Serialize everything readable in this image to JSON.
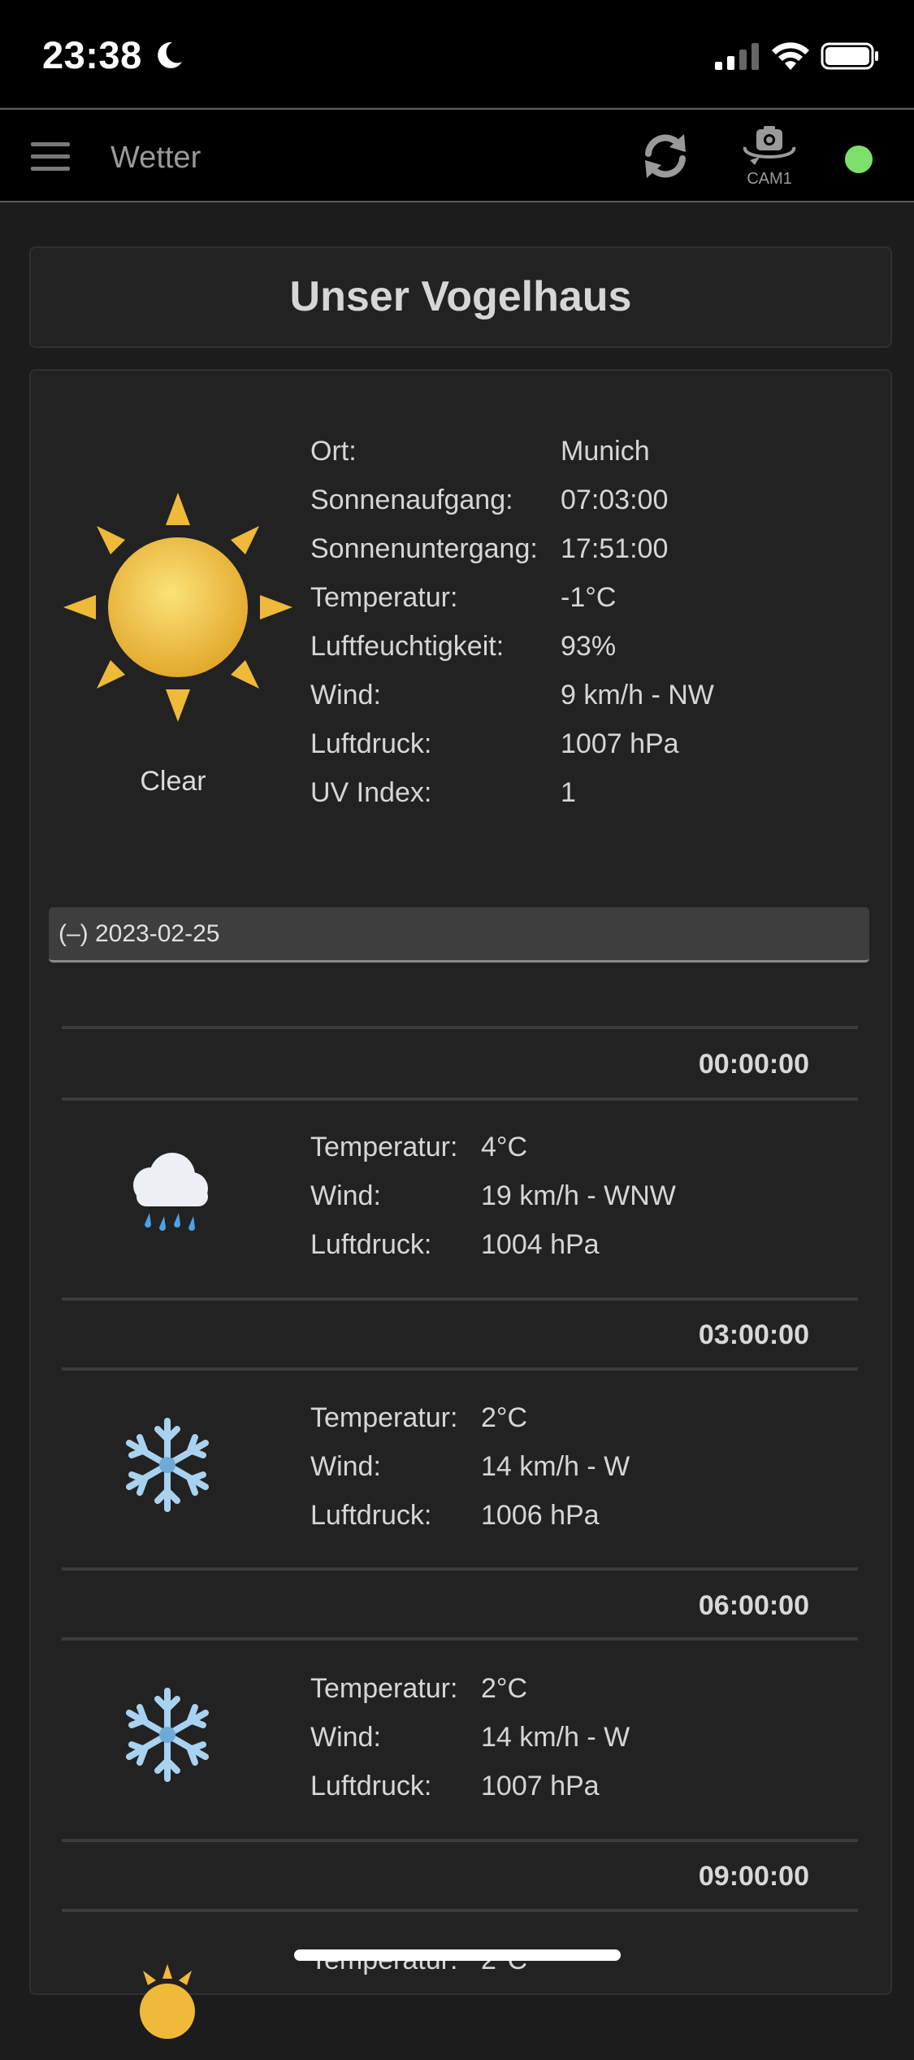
{
  "status_bar": {
    "time": "23:38",
    "icons": [
      "moon-icon",
      "cellular-signal-icon",
      "wifi-icon",
      "battery-icon"
    ]
  },
  "app_bar": {
    "title": "Wetter",
    "cam_label": "CAM1",
    "status_color": "#7ee06c",
    "icons": [
      "menu-icon",
      "refresh-icon",
      "camera-rotate-icon"
    ]
  },
  "page_title": "Unser Vogelhaus",
  "current": {
    "icon": "sun-icon",
    "condition": "Clear",
    "rows": [
      {
        "label": "Ort:",
        "value": "Munich"
      },
      {
        "label": "Sonnenaufgang:",
        "value": "07:03:00"
      },
      {
        "label": "Sonnenuntergang:",
        "value": "17:51:00"
      },
      {
        "label": "Temperatur:",
        "value": "-1°C"
      },
      {
        "label": "Luftfeuchtigkeit:",
        "value": "93%"
      },
      {
        "label": "Wind:",
        "value": "9 km/h - NW"
      },
      {
        "label": "Luftdruck:",
        "value": "1007 hPa"
      },
      {
        "label": "UV Index:",
        "value": "1"
      }
    ]
  },
  "forecast_day": {
    "label": "(–) 2023-02-25",
    "entries": [
      {
        "time": "00:00:00",
        "icon": "rain-cloud-icon",
        "rows": [
          {
            "label": "Temperatur:",
            "value": "4°C"
          },
          {
            "label": "Wind:",
            "value": "19 km/h - WNW"
          },
          {
            "label": "Luftdruck:",
            "value": "1004 hPa"
          }
        ]
      },
      {
        "time": "03:00:00",
        "icon": "snowflake-icon",
        "rows": [
          {
            "label": "Temperatur:",
            "value": "2°C"
          },
          {
            "label": "Wind:",
            "value": "14 km/h - W"
          },
          {
            "label": "Luftdruck:",
            "value": "1006 hPa"
          }
        ]
      },
      {
        "time": "06:00:00",
        "icon": "snowflake-icon",
        "rows": [
          {
            "label": "Temperatur:",
            "value": "2°C"
          },
          {
            "label": "Wind:",
            "value": "14 km/h - W"
          },
          {
            "label": "Luftdruck:",
            "value": "1007 hPa"
          }
        ]
      },
      {
        "time": "09:00:00",
        "icon": "sun-icon",
        "rows": [
          {
            "label": "Temperatur:",
            "value": "2°C"
          }
        ]
      }
    ]
  }
}
